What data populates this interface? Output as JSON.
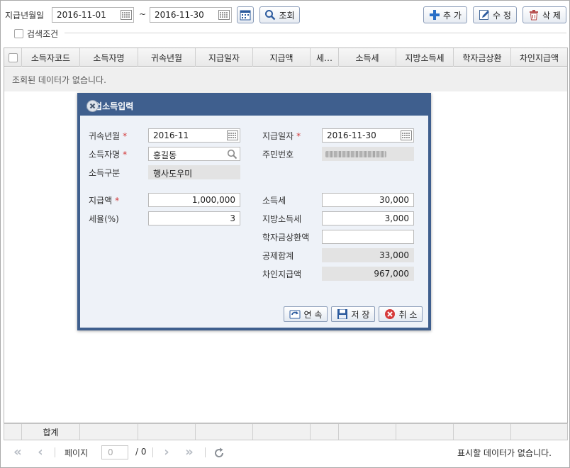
{
  "search": {
    "period_label": "지급년월일",
    "date_from": "2016-11-01",
    "date_to": "2016-11-30",
    "range_sep": "~",
    "search_label": "조회",
    "condition_label": "검색조건"
  },
  "toolbar": {
    "add_label": "추 가",
    "edit_label": "수 정",
    "delete_label": "삭 제"
  },
  "grid": {
    "columns": [
      "소득자코드",
      "소득자명",
      "귀속년월",
      "지급일자",
      "지급액",
      "세…",
      "소득세",
      "지방소득세",
      "학자금상환",
      "차인지급액"
    ],
    "empty_message": "조회된 데이터가 없습니다.",
    "footer_total_label": "합계"
  },
  "pager": {
    "page_label": "페이지",
    "page_value": "0",
    "page_total": "/ 0",
    "status": "표시할 데이터가 없습니다."
  },
  "modal": {
    "title": "사업소득입력",
    "fields": {
      "attr_month_label": "귀속년월",
      "attr_month_value": "2016-11",
      "pay_date_label": "지급일자",
      "pay_date_value": "2016-11-30",
      "earner_name_label": "소득자명",
      "earner_name_value": "홍길동",
      "resident_no_label": "주민번호",
      "income_type_label": "소득구분",
      "income_type_value": "행사도우미",
      "pay_amount_label": "지급액",
      "pay_amount_value": "1,000,000",
      "tax_rate_label": "세율(%)",
      "tax_rate_value": "3",
      "income_tax_label": "소득세",
      "income_tax_value": "30,000",
      "local_tax_label": "지방소득세",
      "local_tax_value": "3,000",
      "loan_repay_label": "학자금상환액",
      "loan_repay_value": "",
      "deduction_total_label": "공제합계",
      "deduction_total_value": "33,000",
      "net_pay_label": "차인지급액",
      "net_pay_value": "967,000"
    },
    "required_mark": "*",
    "buttons": {
      "continue_label": "연 속",
      "save_label": "저 장",
      "cancel_label": "취 소"
    }
  },
  "colors": {
    "modal_header": "#3f5f8e",
    "required": "#d23636"
  },
  "icons": [
    "calendar-icon",
    "search-icon",
    "plus-icon",
    "edit-icon",
    "trash-icon",
    "close-icon",
    "floppy-icon",
    "continue-icon",
    "cancel-icon",
    "first-page-icon",
    "prev-page-icon",
    "next-page-icon",
    "last-page-icon",
    "refresh-icon"
  ]
}
